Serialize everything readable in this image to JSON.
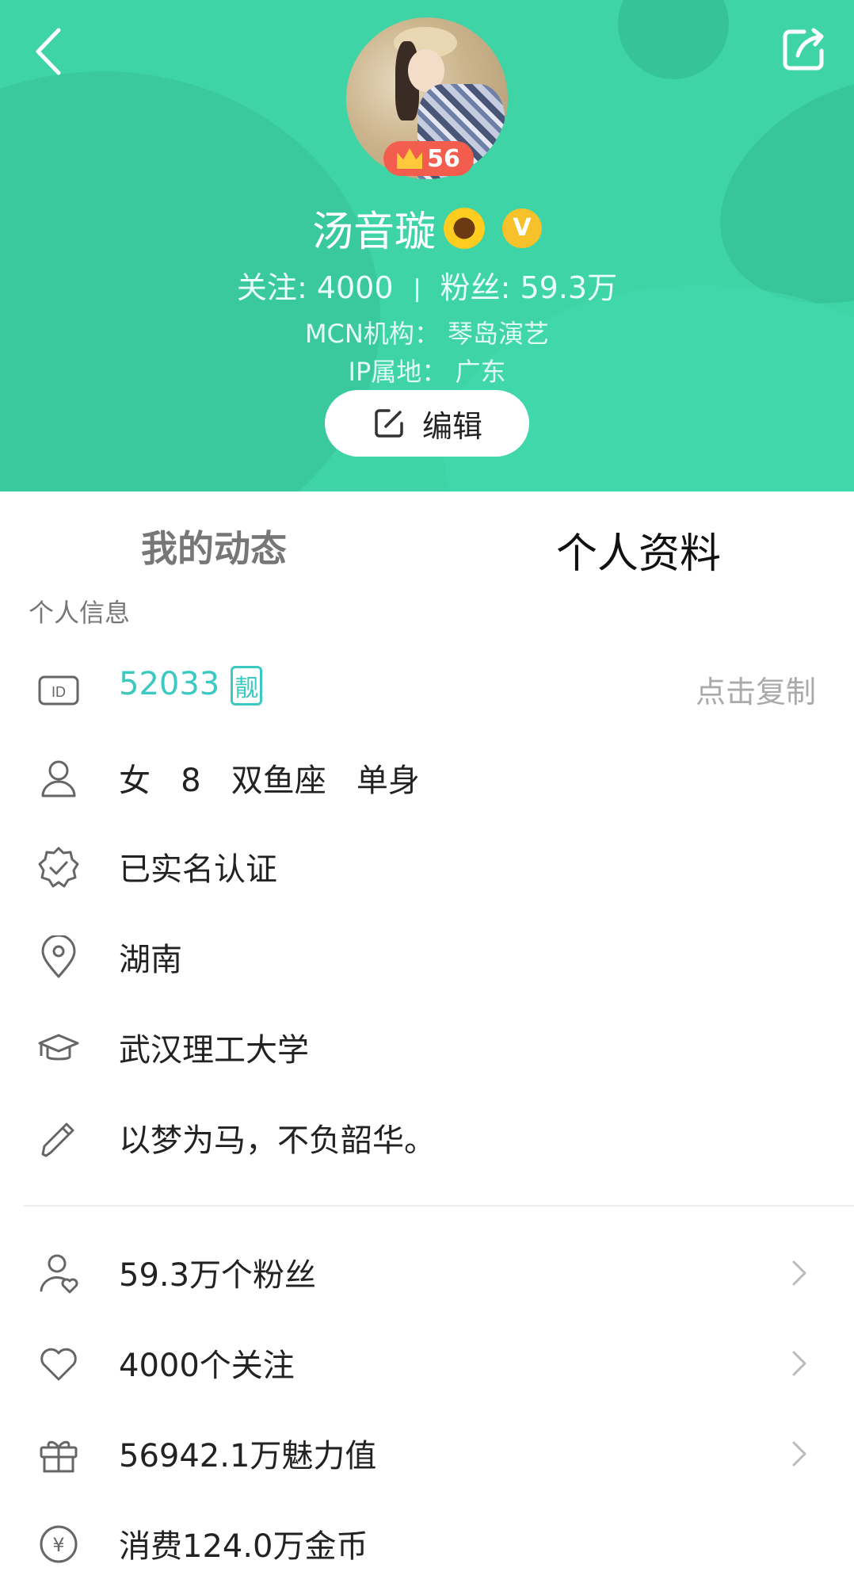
{
  "header": {
    "name": "汤音璇",
    "level": "56",
    "vip_mark": "V",
    "follow_label": "关注",
    "follow_count": "4000",
    "fans_label": "粉丝",
    "fans_count": "59.3万",
    "mcn_label": "MCN机构",
    "mcn_value": "琴岛演艺",
    "ip_label": "IP属地",
    "ip_value": "广东",
    "edit_label": "编辑",
    "colors": {
      "bg": "#3ed4a6",
      "badge": "#f25d4e",
      "vip": "#f6c12b"
    }
  },
  "tabs": [
    {
      "label": "我的动态",
      "active": false
    },
    {
      "label": "个人资料",
      "active": true
    }
  ],
  "section_title": "个人信息",
  "info": {
    "id_value": "52033",
    "id_badge": "靓",
    "copy_label": "点击复制",
    "basic": [
      "女",
      "8",
      "双鱼座",
      "单身"
    ],
    "verify": "已实名认证",
    "location": "湖南",
    "school": "武汉理工大学",
    "signature": "以梦为马，不负韶华。"
  },
  "stats": [
    {
      "label": "59.3万个粉丝",
      "icon": "fans-icon"
    },
    {
      "label": "4000个关注",
      "icon": "heart-icon"
    },
    {
      "label": "56942.1万魅力值",
      "icon": "gift-icon"
    },
    {
      "label": "消费124.0万金币",
      "icon": "coin-icon"
    }
  ]
}
